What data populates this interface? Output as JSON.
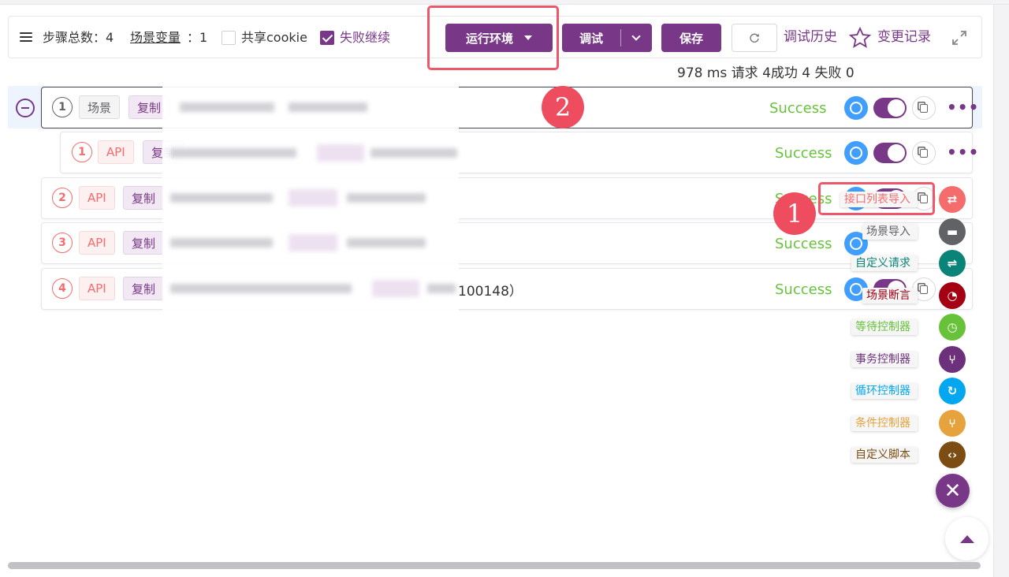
{
  "toolbar": {
    "step_total_label": "步骤总数：4",
    "scene_var_label": "场景变量",
    "scene_var_value": "：1",
    "share_cookie_label": "共享cookie",
    "share_cookie_checked": false,
    "continue_on_fail_label": "失败继续",
    "continue_on_fail_checked": true,
    "env_button_label": "运行环境",
    "debug_button_label": "调试",
    "save_button_label": "保存",
    "debug_history_label": "调试历史",
    "change_log_label": "变更记录"
  },
  "stats": "978 ms 请求 4成功 4 失败 0",
  "steps": [
    {
      "index": "1",
      "type": "场景",
      "copy": "复制",
      "status": "Success",
      "level": 0
    },
    {
      "index": "1",
      "type": "API",
      "copy": "复制",
      "status": "Success",
      "level": 1
    },
    {
      "index": "2",
      "type": "API",
      "copy": "复制",
      "status": "Success",
      "level": 0
    },
    {
      "index": "3",
      "type": "API",
      "copy": "复制",
      "status": "Success",
      "level": 0
    },
    {
      "index": "4",
      "type": "API",
      "copy": "复制",
      "status": "Success",
      "level": 0,
      "visible_tail": "100148）"
    }
  ],
  "add_menu": [
    {
      "label": "接口列表导入",
      "icon": "api-import-icon",
      "color": "#f56c6c"
    },
    {
      "label": "场景导入",
      "icon": "scene-import-icon",
      "color": "#606266"
    },
    {
      "label": "自定义请求",
      "icon": "custom-request-icon",
      "color": "#0a8478"
    },
    {
      "label": "场景断言",
      "icon": "scene-assert-icon",
      "color": "#a30014"
    },
    {
      "label": "等待控制器",
      "icon": "wait-controller-icon",
      "color": "#67c23a"
    },
    {
      "label": "事务控制器",
      "icon": "transaction-controller-icon",
      "color": "#6d317c"
    },
    {
      "label": "循环控制器",
      "icon": "loop-controller-icon",
      "color": "#02a7f0"
    },
    {
      "label": "条件控制器",
      "icon": "if-controller-icon",
      "color": "#e6a23c"
    },
    {
      "label": "自定义脚本",
      "icon": "custom-script-icon",
      "color": "#7b4d12"
    }
  ],
  "annotations": [
    "1",
    "2"
  ],
  "colors": {
    "brand": "#783887",
    "success": "#67c23a",
    "annotation": "#f0566a"
  }
}
